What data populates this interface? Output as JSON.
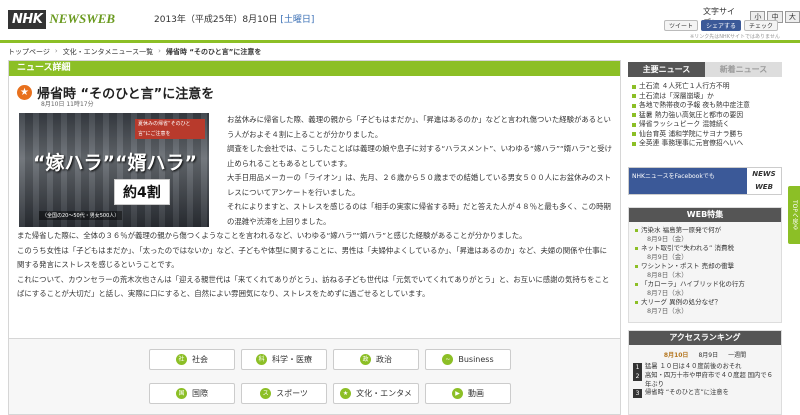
{
  "header": {
    "logo_nhk": "NHK",
    "logo_news": "NEWSWEB",
    "date": "2013年（平成25年）8月10日",
    "weekday": "[土曜日]",
    "font_size_label": "文字サイズ：",
    "font_sizes": [
      "小",
      "中",
      "大"
    ],
    "share": {
      "tweet": "ツイート",
      "facebook": "シェアする",
      "check": "チェック"
    },
    "share_note": "※リンク先はNHKサイトではありません"
  },
  "breadcrumb": [
    "トップページ",
    "文化・エンタメニュース一覧",
    "帰省時 “そのひと言”に注意を"
  ],
  "main": {
    "section_title": "ニュース詳細",
    "article": {
      "title": "帰省時 “そのひと言”に注意を",
      "time": "8月10日 11時17分",
      "photo": {
        "caption": "夏休みの帰省“そのひと言”にご注意を",
        "headline": "“嫁ハラ”“婿ハラ”",
        "amount": "約4割",
        "sub": "（全国の20～50代・男女500人）"
      },
      "paragraphs": [
        "お盆休みに帰省した際、義理の親から「子どもはまだか」、「昇進はあるのか」などと言われ傷ついた経験があるという人がおよそ４割に上ることが分かりました。",
        "調査をした会社では、こうしたことばは義理の娘や息子に対する“ハラスメント”、いわゆる“嫁ハラ”“婿ハラ”と受け止められることもあるとしています。",
        "大手日用品メーカーの「ライオン」は、先月、２６歳から５０歳までの結婚している男女５００人にお盆休みのストレスについてアンケートを行いました。",
        "それによりますと、ストレスを感じるのは「相手の実家に帰省する時」だと答えた人が４８％と最も多く、この時期の混雑や渋滞を上回りました。",
        "また帰省した際に、全体の３６％が義理の親から傷つくようなことを言われるなど、いわゆる“嫁ハラ”“婿ハラ”と感じた経験があることが分かりました。",
        "このうち女性は「子どもはまだか」、「太ったのではないか」など、子どもや体型に関することに、男性は「夫婦仲よくしているか」、「昇進はあるのか」など、夫婦の関係や仕事に関する発言にストレスを感じるということです。",
        "これについて、カウンセラーの荒木次也さんは「迎える親世代は「来てくれてありがとう」、訪ねる子ども世代は「元気でいてくれてありがとう」と、お互いに感謝の気持ちをことばにすることが大切だ」と話し、実際に口にすると、自然によい雰囲気になり、ストレスをためずに過ごせるとしています。"
      ]
    }
  },
  "categories": [
    {
      "label": "社会",
      "icon": "social-icon"
    },
    {
      "label": "科学・医療",
      "icon": "science-icon"
    },
    {
      "label": "政治",
      "icon": "politics-icon"
    },
    {
      "label": "Business",
      "icon": "business-icon"
    },
    {
      "label": "国際",
      "icon": "world-icon"
    },
    {
      "label": "スポーツ",
      "icon": "sports-icon"
    },
    {
      "label": "文化・エンタメ",
      "icon": "culture-icon"
    },
    {
      "label": "動画",
      "icon": "video-icon"
    }
  ],
  "sidebar": {
    "tabs": [
      "主要ニュース",
      "新着ニュース"
    ],
    "main_news": [
      "土石流 ４人死亡１人行方不明",
      "土石流は「深層崩壊」か",
      "各地で熱帯夜の予報 夜も熱中症注意",
      "猛暑 熱力強い高気圧と都市の要因",
      "帰省ラッシュピーク 混雑続く",
      "仙台育英 浦和学院にサヨナラ勝ち",
      "全英連 事務理事に元官僚招へいへ"
    ],
    "fb_banner": {
      "text": "NHKニュースをFacebookでも",
      "brand": "NEWS WEB"
    },
    "web_feature": {
      "title": "WEB特集",
      "items": [
        {
          "title": "汚染水 福島第一原発で何が",
          "date": "8月9日（金）"
        },
        {
          "title": "ネット取引で“失われる” 消費税",
          "date": "8月9日（金）"
        },
        {
          "title": "ワシントン・ポスト 売却の衝撃",
          "date": "8月8日（木）"
        },
        {
          "title": "「カローラ」ハイブリッド化の行方",
          "date": "8月7日（水）"
        },
        {
          "title": "大リーグ 異例の処分なぜ？",
          "date": "8月7日（水）"
        }
      ]
    },
    "ranking": {
      "title": "アクセスランキング",
      "tabs": [
        "8月10日",
        "8月9日",
        "一週間"
      ],
      "items": [
        {
          "num": "1",
          "text": "猛暑 １０日は４０度前後のおそれ"
        },
        {
          "num": "2",
          "text": "高知・四万十市や甲府市で４０度超 国内で６年ぶり"
        },
        {
          "num": "3",
          "text": "帰省時 “そのひと言”に注意を"
        }
      ]
    }
  },
  "totop": "TOPへ戻る",
  "colors": {
    "accent": "#8cbf26",
    "title_icon": "#e8711e",
    "dark_tab": "#555555"
  }
}
